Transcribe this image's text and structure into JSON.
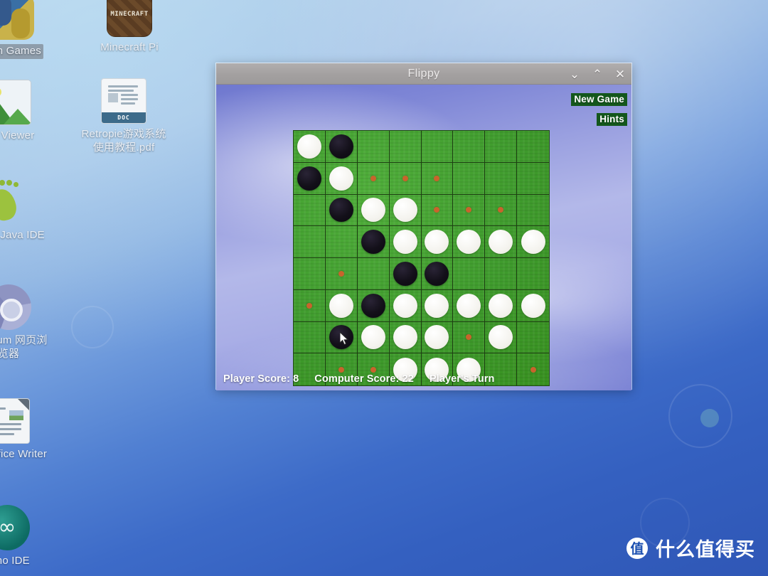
{
  "desktop": {
    "icons": [
      {
        "name": "python-games",
        "label": "...on Games",
        "selected": true
      },
      {
        "name": "minecraft-pi",
        "label": "Minecraft Pi",
        "badge": "MINECRAFT"
      },
      {
        "name": "image-viewer",
        "label": "...e Viewer"
      },
      {
        "name": "retropie-pdf",
        "label": "Retropie游戏系统使用教程.pdf",
        "badge": "DOC"
      },
      {
        "name": "greenfoot-java-ide",
        "label": "...foot Java IDE"
      },
      {
        "name": "chromium-browser",
        "label": "...omium 网页浏览器"
      },
      {
        "name": "libreoffice-writer",
        "label": "...reOffice Writer"
      },
      {
        "name": "arduino-ide",
        "label": "...ino IDE"
      }
    ]
  },
  "window": {
    "title": "Flippy",
    "controls": {
      "minimize": "⌄",
      "maximize": "⌃",
      "close": "✕"
    },
    "buttons": {
      "new_game": "New Game",
      "hints": "Hints"
    },
    "status": {
      "player_score": "Player Score: 8",
      "computer_score": "Computer Score: 22",
      "turn": "Player's Turn"
    }
  },
  "board": {
    "rows": 8,
    "cols": 8,
    "legend": {
      "e": "empty",
      "w": "white-disc",
      "b": "black-disc",
      "h": "hint-marker"
    },
    "cells": [
      [
        "w",
        "b",
        "e",
        "e",
        "e",
        "e",
        "e",
        "e"
      ],
      [
        "b",
        "w",
        "h",
        "h",
        "h",
        "e",
        "e",
        "e"
      ],
      [
        "e",
        "b",
        "w",
        "w",
        "h",
        "h",
        "h",
        "e"
      ],
      [
        "e",
        "e",
        "b",
        "w",
        "w",
        "w",
        "w",
        "w"
      ],
      [
        "e",
        "h",
        "e",
        "b",
        "b",
        "e",
        "e",
        "e"
      ],
      [
        "h",
        "w",
        "b",
        "w",
        "w",
        "w",
        "w",
        "w"
      ],
      [
        "e",
        "b",
        "w",
        "w",
        "w",
        "h",
        "w",
        "e"
      ],
      [
        "e",
        "h",
        "h",
        "w",
        "w",
        "w",
        "e",
        "h"
      ]
    ],
    "cursor_cell": {
      "row": 6,
      "col": 1
    }
  },
  "watermark": {
    "logo": "值",
    "text": "什么值得买"
  },
  "colors": {
    "board_green": "#3e9a2c",
    "hint_orange": "#c8642c",
    "button_green": "#14571c",
    "titlebar_gray": "#a3a0a0",
    "desktop_blue": "#3460c0"
  }
}
